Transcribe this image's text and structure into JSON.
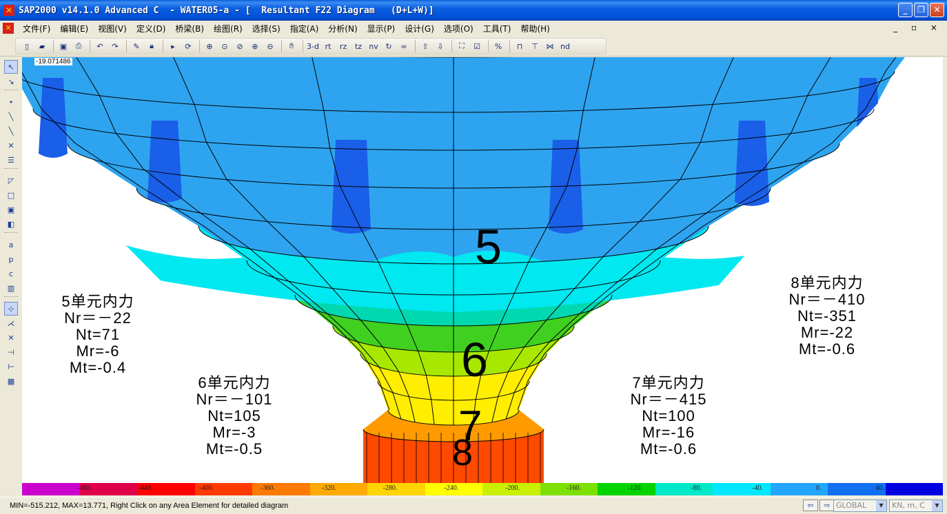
{
  "window": {
    "title": "SAP2000 v14.1.0 Advanced C  - WATER05-a - [  Resultant F22 Diagram   (D+L+W)]",
    "min_label": "_",
    "max_label": "❐",
    "close_label": "✕"
  },
  "menu": {
    "items": [
      "文件(F)",
      "编辑(E)",
      "视图(V)",
      "定义(D)",
      "桥梁(B)",
      "绘图(R)",
      "选择(S)",
      "指定(A)",
      "分析(N)",
      "显示(P)",
      "设计(G)",
      "选项(O)",
      "工具(T)",
      "帮助(H)"
    ],
    "mdi_controls": "_ ▫ ×"
  },
  "toolbar": {
    "view_3d": "3-d",
    "view_rt": "rt",
    "view_rz": "rz",
    "view_tz": "tz",
    "view_nv": "nv",
    "view_nd": "nd"
  },
  "canvas": {
    "coord_readout": "-19.071486",
    "zones": [
      "5",
      "6",
      "7",
      "8"
    ],
    "force_blocks": [
      {
        "id": "elem5",
        "title": "5单元内力",
        "nr": "Nr＝－22",
        "nt": "Nt=71",
        "mr": "Mr=-6",
        "mt": "Mt=-0.4"
      },
      {
        "id": "elem6",
        "title": "6单元内力",
        "nr": "Nr＝－101",
        "nt": "Nt=105",
        "mr": "Mr=-3",
        "mt": "Mt=-0.5"
      },
      {
        "id": "elem7",
        "title": "7单元内力",
        "nr": "Nr＝－415",
        "nt": "Nt=100",
        "mr": "Mr=-16",
        "mt": "Mt=-0.6"
      },
      {
        "id": "elem8",
        "title": "8单元内力",
        "nr": "Nr＝－410",
        "nt": "Nt=-351",
        "mr": "Mr=-22",
        "mt": "Mt=-0.6"
      }
    ]
  },
  "legend": {
    "labels": [
      "-480.",
      "-440.",
      "-400.",
      "-360.",
      "-320.",
      "-280.",
      "-240.",
      "-200.",
      "-160.",
      "-120.",
      "-80.",
      "-40.",
      "0.",
      "40."
    ],
    "colors": [
      "#cc00cc",
      "#e0004a",
      "#ff0000",
      "#ff3a00",
      "#ff7a00",
      "#ffaa00",
      "#ffd400",
      "#ffff00",
      "#c8f000",
      "#7ee000",
      "#00d400",
      "#00e8c8",
      "#00e8ff",
      "#22a6ff",
      "#1070f0",
      "#0000e0"
    ]
  },
  "contour_colors": {
    "deep_blue": "#1a5fe8",
    "mid_blue": "#2ea4f0",
    "cyan": "#00e8f0",
    "teal": "#00d8b0",
    "green": "#40d020",
    "lime": "#a8e800",
    "yellow": "#ffee00",
    "orange": "#ff9a00",
    "red": "#ff4a00"
  },
  "status": {
    "text": "MIN=-515.212, MAX=13.771, Right Click on any Area Element for detailed diagram",
    "coord_system": "GLOBAL",
    "units": "KN, m, C"
  }
}
